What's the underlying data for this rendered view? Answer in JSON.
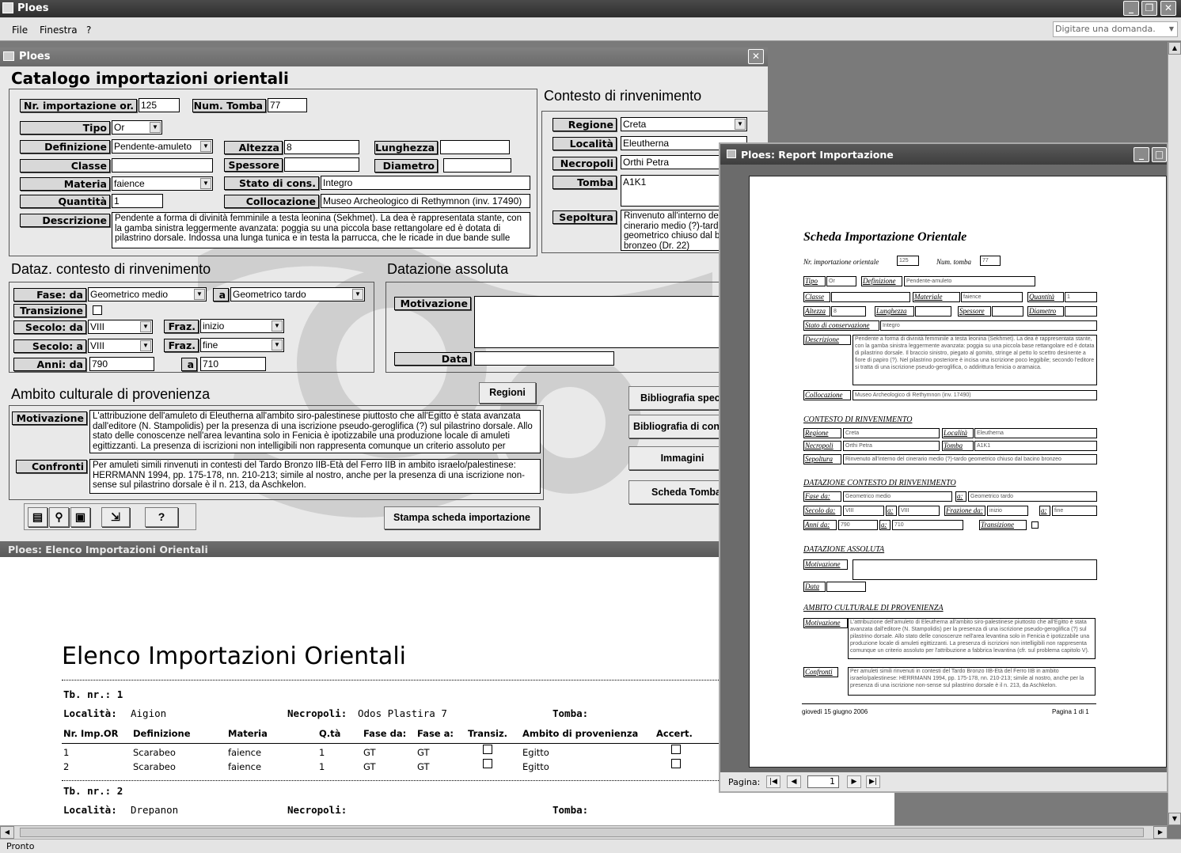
{
  "app": {
    "title": "Ploes",
    "menu": [
      "File",
      "Finestra",
      "?"
    ],
    "help_placeholder": "Digitare una domanda.",
    "status": "Pronto"
  },
  "form": {
    "window_title": "Ploes",
    "heading": "Catalogo importazioni orientali",
    "fields": {
      "nr_importazione": {
        "label": "Nr. importazione or.",
        "value": "125"
      },
      "num_tomba": {
        "label": "Num. Tomba",
        "value": "77"
      },
      "tipo": {
        "label": "Tipo",
        "value": "Or"
      },
      "definizione": {
        "label": "Definizione",
        "value": "Pendente-amuleto"
      },
      "altezza": {
        "label": "Altezza",
        "value": "8"
      },
      "lunghezza": {
        "label": "Lunghezza",
        "value": ""
      },
      "classe": {
        "label": "Classe",
        "value": ""
      },
      "spessore": {
        "label": "Spessore",
        "value": ""
      },
      "diametro": {
        "label": "Diametro",
        "value": ""
      },
      "materia": {
        "label": "Materia",
        "value": "faience"
      },
      "stato": {
        "label": "Stato di cons.",
        "value": "Integro"
      },
      "quantita": {
        "label": "Quantità",
        "value": "1"
      },
      "collocazione": {
        "label": "Collocazione",
        "value": "Museo Archeologico di Rethymnon (inv. 17490)"
      },
      "descrizione": {
        "label": "Descrizione",
        "value": "Pendente a forma di divinità femminile a testa leonina (Sekhmet). La dea è rappresentata stante, con la gamba sinistra leggermente avanzata: poggia su una piccola base rettangolare ed è dotata di pilastrino dorsale. Indossa una lunga tunica e in testa la parrucca, che le ricade in due bande sulle"
      }
    },
    "contesto": {
      "heading": "Contesto di rinvenimento",
      "regione": {
        "label": "Regione",
        "value": "Creta"
      },
      "localita": {
        "label": "Località",
        "value": "Eleutherna"
      },
      "necropoli": {
        "label": "Necropoli",
        "value": "Orthi Petra"
      },
      "tomba": {
        "label": "Tomba",
        "value": "A1K1"
      },
      "sepoltura": {
        "label": "Sepoltura",
        "value": "Rinvenuto all'interno del cinerario medio (?)-tardo geometrico chiuso dal bacino bronzeo (Dr. 22)"
      }
    },
    "datazione": {
      "heading": "Dataz. contesto di rinvenimento",
      "fase_da": {
        "label": "Fase: da",
        "value": "Geometrico medio"
      },
      "fase_a": {
        "label": "a",
        "value": "Geometrico tardo"
      },
      "transizione": {
        "label": "Transizione"
      },
      "secolo_da": {
        "label": "Secolo: da",
        "value": "VIII"
      },
      "fraz_da": {
        "label": "Fraz.",
        "value": "inizio"
      },
      "secolo_a": {
        "label": "Secolo: a",
        "value": "VIII"
      },
      "fraz_a": {
        "label": "Fraz.",
        "value": "fine"
      },
      "anni_da": {
        "label": "Anni: da",
        "value": "790"
      },
      "anni_a": {
        "label": "a",
        "value": "710"
      }
    },
    "assoluta": {
      "heading": "Datazione assoluta",
      "motivazione": {
        "label": "Motivazione",
        "value": ""
      },
      "data": {
        "label": "Data",
        "value": ""
      }
    },
    "ambito": {
      "heading": "Ambito culturale di provenienza",
      "regioni_button": "Regioni",
      "motivazione": {
        "label": "Motivazione",
        "value": "L'attribuzione dell'amuleto di Eleutherna all'ambito siro-palestinese piuttosto che all'Egitto è stata avanzata dall'editore (N. Stampolidis) per la presenza di una iscrizione pseudo-geroglifica (?) sul pilastrino dorsale. Allo stato delle conoscenze nell'area levantina solo in Fenicia è ipotizzabile una produzione locale di amuleti egittizzanti. La presenza di iscrizioni non intelligibili non rappresenta comunque un criterio assoluto per"
      },
      "confronti": {
        "label": "Confronti",
        "value": "Per amuleti simili rinvenuti in contesti del Tardo Bronzo IIB-Età del Ferro IIB in ambito israelo/palestinese: HERRMANN 1994, pp. 175-178, nn. 210-213; simile al nostro, anche per la presenza di una iscrizione non-sense sul pilastrino dorsale è il n. 213, da Aschkelon."
      }
    },
    "side_buttons": [
      "Bibliografia spec",
      "Bibliografia di con",
      "Immagini",
      "Scheda Tomba"
    ],
    "print_button": "Stampa scheda importazione",
    "toolbar_icons": [
      "form-icon",
      "binoculars-icon",
      "delete-icon",
      "new-record-icon",
      "help-icon"
    ],
    "toolbar_glyphs": [
      "▤",
      "⚲",
      "▣",
      "⇲",
      "?"
    ]
  },
  "list": {
    "window_title": "Ploes: Elenco Importazioni Orientali",
    "heading": "Elenco Importazioni Orientali",
    "columns": [
      "Nr. Imp.OR",
      "Definizione",
      "Materia",
      "Q.tà",
      "Fase da:",
      "Fase a:",
      "Transiz.",
      "Ambito di provenienza",
      "Accert."
    ],
    "groups": [
      {
        "tb": "Tb. nr.:  1",
        "localita_label": "Località:",
        "localita": "Aigion",
        "necropoli_label": "Necropoli:",
        "necropoli": "Odos Plastira 7",
        "tomba_label": "Tomba:",
        "rows": [
          [
            "1",
            "Scarabeo",
            "faience",
            "1",
            "GT",
            "GT",
            "",
            "Egitto",
            ""
          ],
          [
            "2",
            "Scarabeo",
            "faience",
            "1",
            "GT",
            "GT",
            "",
            "Egitto",
            ""
          ]
        ]
      },
      {
        "tb": "Tb. nr.:  2",
        "localita_label": "Località:",
        "localita": "Drepanon",
        "necropoli_label": "Necropoli:",
        "necropoli": "",
        "tomba_label": "Tomba:",
        "rows": []
      }
    ]
  },
  "report": {
    "window_title": "Ploes: Report Importazione",
    "title": "Scheda Importazione Orientale",
    "nr_label": "Nr. importazione orientale",
    "nr": "125",
    "tomba_label": "Num. tomba",
    "tomba": "77",
    "tipo_label": "Tipo",
    "tipo": "Or",
    "def_label": "Definizione",
    "def": "Pendente-amuleto",
    "classe_label": "Classe",
    "materiale_label": "Materiale",
    "materiale": "faience",
    "quantita_label": "Quantità",
    "quantita": "1",
    "altezza_label": "Altezza",
    "altezza": "8",
    "lunghezza_label": "Lunghezza",
    "spessore_label": "Spessore",
    "diametro_label": "Diametro",
    "stato_label": "Stato di conservazione",
    "stato": "Integro",
    "descr_label": "Descrizione",
    "descr": "Pendente a forma di divinità femminile a testa leonina (Sekhmet). La dea è rappresentata stante, con la gamba sinistra leggermente avanzata: poggia su una piccola base rettangolare ed è dotata di pilastrino dorsale. Il braccio sinistro, piegato al gomito, stringe al petto lo scettro desinente a fiore di papiro (?). Nel pilastrino posteriore è incisa una iscrizione poco leggibile; secondo l'editore si tratta di una iscrizione pseudo-geroglifica, o addirittura fenicia o aramaica.",
    "colloc_label": "Collocazione",
    "colloc": "Museo Archeologico di Rethymnon (inv. 17490)",
    "contesto_heading": "CONTESTO DI RINVENIMENTO",
    "regione_label": "Regione",
    "regione": "Creta",
    "localita_label": "Località",
    "localita": "Eleutherna",
    "necropoli_label": "Necropoli",
    "necropoli": "Orthi Petra",
    "tomba2_label": "Tomba",
    "tomba2": "A1K1",
    "sepoltura_label": "Sepoltura",
    "sepoltura": "Rinvenuto all'interno del cinerario medio (?)-tardo geometrico chiuso dal bacino bronzeo",
    "dataz_heading": "DATAZIONE CONTESTO DI RINVENIMENTO",
    "fase_label": "Fase da:",
    "fase_da": "Geometrico medio",
    "a_label": "a:",
    "fase_a": "Geometrico tardo",
    "secolo_label": "Secolo da:",
    "secolo_da": "VIII",
    "secolo_a": "VIII",
    "frazione_label": "Frazione da:",
    "fraz_da": "inizio",
    "fraz_a": "fine",
    "anni_label": "Anni da:",
    "anni_da": "790",
    "anni_a": "710",
    "transizione_label": "Transizione",
    "assoluta_heading": "DATAZIONE ASSOLUTA",
    "motivazione_label": "Motivazione",
    "data_label": "Data",
    "ambito_heading": "AMBITO CULTURALE DI PROVENIENZA",
    "amb_motiv": "L'attribuzione dell'amuleto di Eleutherna all'ambito siro-palestinese piuttosto che all'Egitto è stata avanzata dall'editore (N. Stampolidis) per la presenza di una iscrizione pseudo-geroglifica (?) sul pilastrino dorsale. Allo stato delle conoscenze nell'area levantina solo in Fenicia è ipotizzabile una produzione locale di amuleti egittizzanti. La presenza di iscrizioni non intelligibili non rappresenta comunque un criterio assoluto per l'attribuzione a fabbrica levantina (cfr. sul problema capitolo V).",
    "confronti_label": "Confronti",
    "confronti": "Per amuleti simili rinvenuti in contesti del Tardo Bronzo IIB-Età del Ferro IIB in ambito israelo/palestinese: HERRMANN 1994, pp. 175-178, nn. 210-213; simile al nostro, anche per la presenza di una iscrizione non-sense sul pilastrino dorsale è il n. 213, da Aschkelon.",
    "footer_date": "giovedì 15 giugno 2006",
    "footer_page": "Pagina 1 di 1",
    "pagina_label": "Pagina:",
    "page": "1"
  }
}
